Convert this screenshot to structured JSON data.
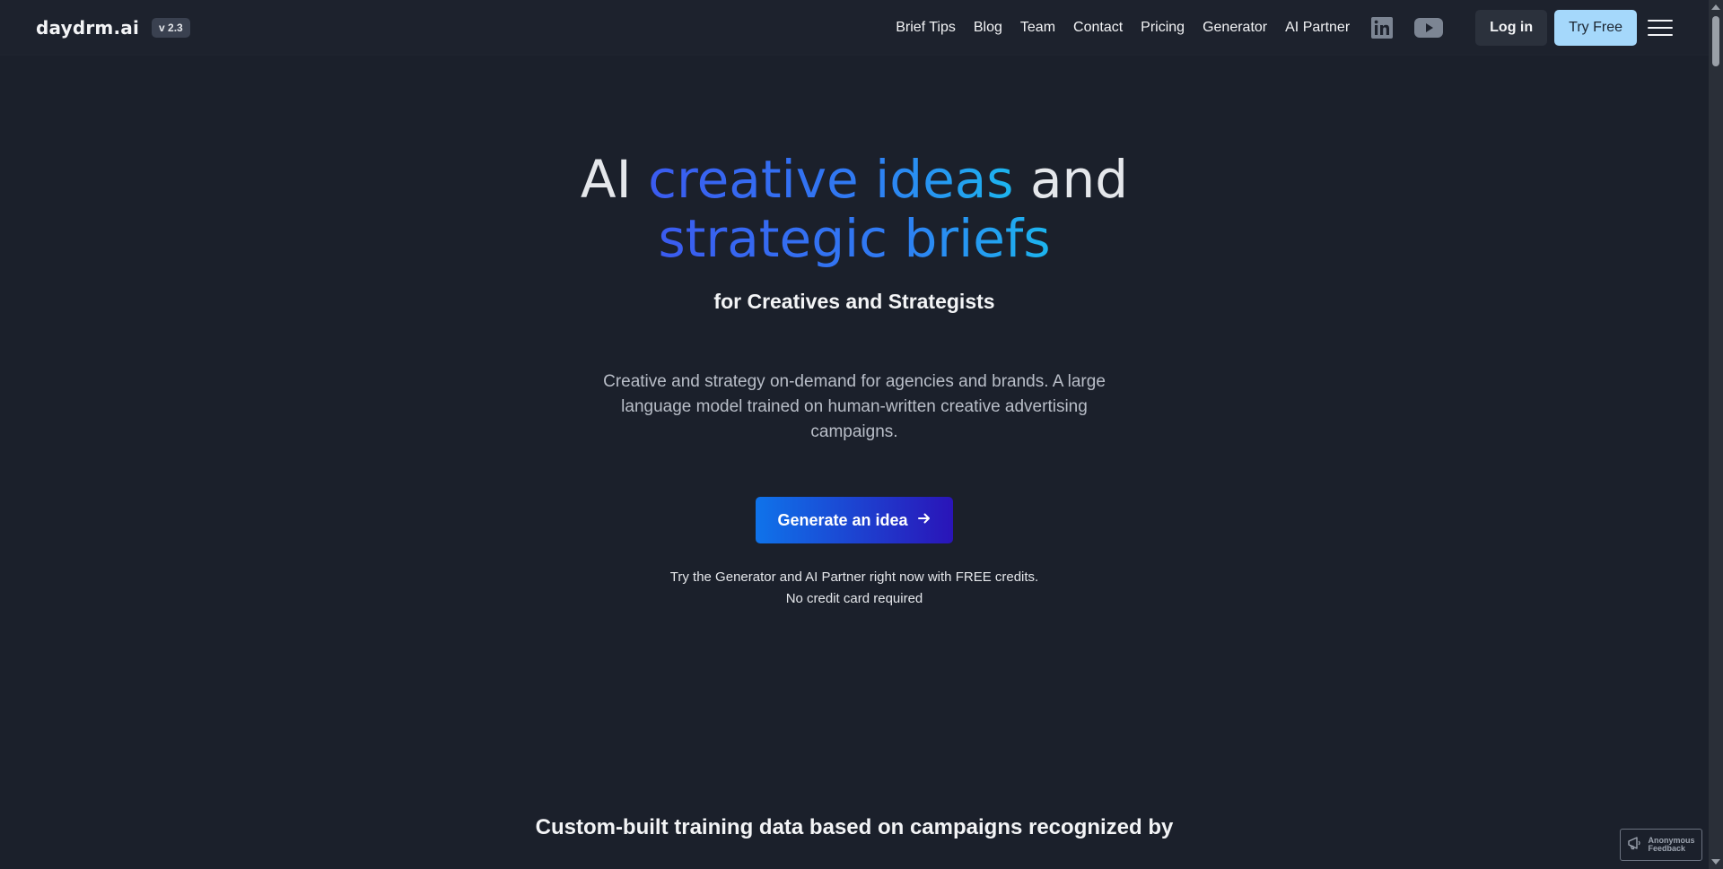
{
  "header": {
    "logo": "daydrm.ai",
    "version": "v 2.3",
    "nav": [
      {
        "label": "Brief Tips"
      },
      {
        "label": "Blog"
      },
      {
        "label": "Team"
      },
      {
        "label": "Contact"
      },
      {
        "label": "Pricing"
      },
      {
        "label": "Generator"
      },
      {
        "label": "AI Partner"
      }
    ],
    "icons": [
      "linkedin-icon",
      "youtube-icon",
      "hamburger-menu-icon"
    ],
    "login_label": "Log in",
    "try_free_label": "Try Free"
  },
  "hero": {
    "title_part1": "AI",
    "title_highlight1": "creative ideas",
    "title_part2": "and",
    "title_highlight2": "strategic briefs",
    "subtitle": "for Creatives and Strategists",
    "description": "Creative and strategy on-demand for agencies and brands. A large language model trained on human-written creative advertising campaigns.",
    "cta_label": "Generate an idea",
    "note_line1": "Try the Generator and AI Partner right now with FREE credits.",
    "note_line2": "No credit card required"
  },
  "section": {
    "training_heading": "Custom-built training data based on campaigns recognized by"
  },
  "feedback": {
    "line1": "Anonymous",
    "line2": "Feedback"
  },
  "colors": {
    "background": "#1b202b",
    "header_bg": "#1d222d",
    "accent_gradient_start": "#3b5bf0",
    "accent_gradient_end": "#1cb6ef",
    "cta_gradient_start": "#0f73ea",
    "cta_gradient_end": "#2a14b8",
    "try_free_bg": "#a5d8fb"
  }
}
